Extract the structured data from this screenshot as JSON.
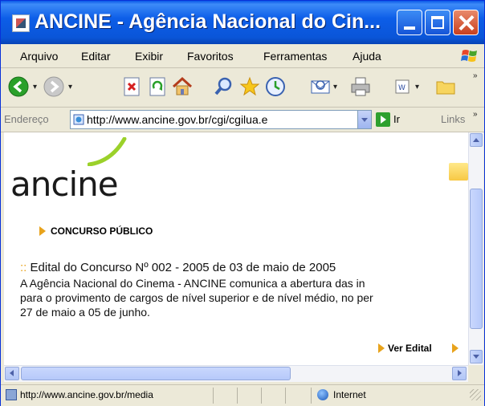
{
  "window": {
    "title": "ANCINE - Agência Nacional do Cin..."
  },
  "menubar": {
    "items": [
      {
        "label": "Arquivo"
      },
      {
        "label": "Editar"
      },
      {
        "label": "Exibir"
      },
      {
        "label": "Favoritos"
      },
      {
        "label": "Ferramentas"
      },
      {
        "label": "Ajuda"
      }
    ]
  },
  "toolbar": {
    "buttons": [
      "back-icon",
      "forward-icon",
      "stop-icon",
      "refresh-icon",
      "home-icon",
      "search-icon",
      "favorites-icon",
      "history-icon",
      "mail-icon",
      "print-icon",
      "edit-icon",
      "folder-icon"
    ]
  },
  "addressbar": {
    "label": "Endereço",
    "url": "http://www.ancine.gov.br/cgi/cgilua.e",
    "go_label": "Ir",
    "links_label": "Links"
  },
  "page": {
    "logo_text": "ancine",
    "section_title": "CONCURSO PÚBLICO",
    "edital_separator": "::",
    "edital_heading": "Edital do Concurso Nº 002 - 2005 de 03 de maio de 2005",
    "body_lines": [
      "A Agência Nacional do Cinema - ANCINE comunica a abertura das in",
      "para o provimento de cargos de nível superior e de nível médio, no per",
      "27 de maio a 05 de junho."
    ],
    "ver_edital": "Ver Edital"
  },
  "statusbar": {
    "text": "http://www.ancine.gov.br/media",
    "zone": "Internet"
  },
  "colors": {
    "title_blue": "#0a55d8",
    "accent_orange": "#e8a31c",
    "logo_green": "#9bd12a"
  }
}
